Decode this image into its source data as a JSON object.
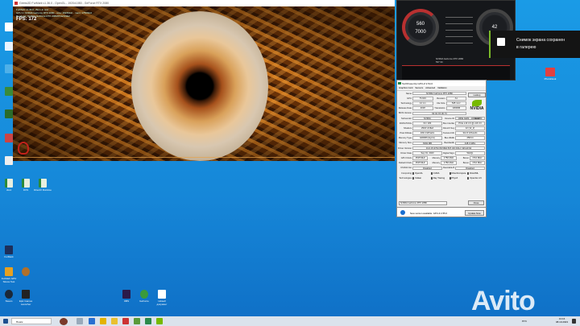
{
  "desktop_icons_left": [
    "",
    "",
    "",
    "",
    "",
    "",
    "",
    "",
    "",
    "",
    ""
  ],
  "desktop_files": [
    {
      "label": "dxs1"
    },
    {
      "label": "DXS"
    },
    {
      "label": "DirectX Runtime"
    }
  ],
  "desktop_apps_bottom_left": [
    {
      "label": "FurMark"
    },
    {
      "label": "FurMark GPU Stress Test"
    },
    {
      "label": "Steam"
    },
    {
      "label": "Epic Games Launcher"
    }
  ],
  "desktop_bottom_icons": [
    {
      "label": "OBS"
    },
    {
      "label": "GeForce"
    },
    {
      "label": "Новый документ"
    }
  ],
  "right_icon": {
    "label": "PhotoDesk"
  },
  "furmark": {
    "title": "Geeks3D FurMark v1.36.0 - OpenGL - 1920x1080 - GeForce RTX 2080",
    "osd_lines": [
      "FurMark v1.36.0 - Burn-in test",
      "GPU 1: NVIDIA GeForce RTX 2080 - core: 1515MHz - mem: 1750MHz",
      "Renderer: NVIDIA GeForce RTX 2080/PCIe/SSE2"
    ],
    "fps": "FPS: 172"
  },
  "afterburner": {
    "gpu_clock": "560",
    "mem_clock": "7000",
    "temp": "42",
    "gpu_name": "NVIDIA GeForce RTX 2080",
    "driver": "537.34"
  },
  "toast": {
    "message_line1": "Снимок экрана сохранен",
    "message_line2": "в галерею"
  },
  "gpuz": {
    "title": "TechPowerUp GPU-Z 2.54.0",
    "tabs": [
      "Graphics Card",
      "Sensors",
      "Advanced",
      "Validation"
    ],
    "lookup": "Lookup",
    "vendor_logo": "NVIDIA",
    "uefi": "UEFI",
    "rows": [
      [
        [
          "l",
          "Name"
        ],
        [
          "v",
          "NVIDIA GeForce RTX 2080",
          3
        ]
      ],
      [
        [
          "l",
          "GPU"
        ],
        [
          "v",
          "TU104"
        ],
        [
          "l",
          "Revision"
        ],
        [
          "v",
          "A1"
        ]
      ],
      [
        [
          "l",
          "Technology"
        ],
        [
          "v",
          "12 nm"
        ],
        [
          "l",
          "Die Size"
        ],
        [
          "v",
          "545 mm²"
        ]
      ],
      [
        [
          "l",
          "Release Date"
        ],
        [
          "v",
          "2018"
        ],
        [
          "l",
          "Transistors"
        ],
        [
          "v",
          "13600M"
        ]
      ],
      [
        [
          "l",
          "BIOS Version"
        ],
        [
          "v",
          "90.04.XX.00.73",
          3
        ]
      ],
      [
        [
          "l",
          "Subvendor"
        ],
        [
          "v",
          "NVIDIA"
        ],
        [
          "l",
          "Device ID"
        ],
        [
          "v",
          "10DE 1E82 - 10DE 12B0"
        ]
      ],
      [
        [
          "l",
          "ROPs/TMUs"
        ],
        [
          "v",
          "64 / 184"
        ],
        [
          "l",
          "Bus Interface"
        ],
        [
          "v",
          "PCIe x16 3.0 @ x16 3.0"
        ]
      ],
      [
        [
          "l",
          "Shaders"
        ],
        [
          "v",
          "2944 Unified"
        ],
        [
          "l",
          "DirectX Support"
        ],
        [
          "v",
          "12 (12_2)"
        ]
      ],
      [
        [
          "l",
          "Pixel Fillrate"
        ],
        [
          "v",
          "109.4 GPixel/s"
        ],
        [
          "l",
          "Texture Fillrate"
        ],
        [
          "v",
          "314.6 GTexel/s"
        ]
      ],
      [
        [
          "l",
          "Memory Type"
        ],
        [
          "v",
          "GDDR6 (Hynix)"
        ],
        [
          "l",
          "Bus Width"
        ],
        [
          "v",
          "256 bit"
        ]
      ],
      [
        [
          "l",
          "Memory Size"
        ],
        [
          "v",
          "8192 MB"
        ],
        [
          "l",
          "Bandwidth"
        ],
        [
          "v",
          "448.0 GB/s"
        ]
      ],
      [
        [
          "l",
          "Driver Version"
        ],
        [
          "v",
          "31.0.15.3734 (NVIDIA 537.34) DCH / Win10 64",
          3
        ]
      ],
      [
        [
          "l",
          "Driver Date"
        ],
        [
          "v",
          "Sep 01, 2023"
        ],
        [
          "l",
          "Digital Signature"
        ],
        [
          "v",
          "WHQL"
        ]
      ],
      [
        [
          "l",
          "GPU Clock"
        ],
        [
          "v",
          "1515 MHz"
        ],
        [
          "l",
          "Memory"
        ],
        [
          "v",
          "1750 MHz"
        ],
        [
          "l",
          "Boost"
        ],
        [
          "v",
          "1710 MHz"
        ]
      ],
      [
        [
          "l",
          "Default Clock"
        ],
        [
          "v",
          "1515 MHz"
        ],
        [
          "l",
          "Memory"
        ],
        [
          "v",
          "1750 MHz"
        ],
        [
          "l",
          "Boost"
        ],
        [
          "v",
          "1710 MHz"
        ]
      ],
      [
        [
          "l",
          "NVIDIA SLI"
        ],
        [
          "v",
          "Disabled"
        ],
        [
          "l",
          "Resizable BAR"
        ],
        [
          "v",
          "Disabled"
        ]
      ],
      [
        [
          "l",
          "Computing"
        ],
        [
          "c",
          "OpenCL"
        ],
        [
          "c",
          "CUDA"
        ],
        [
          "c",
          "DirectCompute"
        ],
        [
          "c",
          "DirectML"
        ]
      ],
      [
        [
          "l",
          "Technologies"
        ],
        [
          "c",
          "Vulkan"
        ],
        [
          "c",
          "Ray Tracing"
        ],
        [
          "c",
          "PhysX"
        ],
        [
          "c",
          "OpenGL 4.6"
        ]
      ]
    ],
    "gpu_select": "NVIDIA GeForce RTX 2080",
    "close": "Close",
    "update_text": "New version available: GPU-Z 2.55.0",
    "update_button": "Update Now"
  },
  "watermark": "Avito",
  "taskbar": {
    "search_placeholder": "Поиск",
    "lang": "РУС",
    "time": "13:16",
    "date": "08.10.2023"
  }
}
